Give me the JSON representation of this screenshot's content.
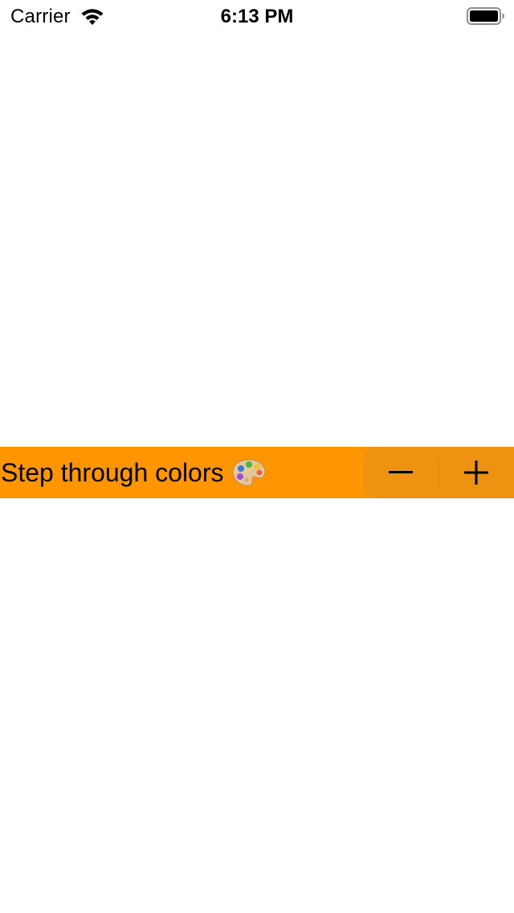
{
  "status_bar": {
    "carrier": "Carrier",
    "time": "6:13 PM"
  },
  "stepper": {
    "label": "Step through colors",
    "label_icon": "artist-palette-icon",
    "decrement_icon": "minus-icon",
    "increment_icon": "plus-icon"
  },
  "colors": {
    "row_background": "#FF9500",
    "stepper_background": "#EE9212",
    "divider": "#DC8910",
    "text": "#000000",
    "page_background": "#FFFFFF"
  }
}
